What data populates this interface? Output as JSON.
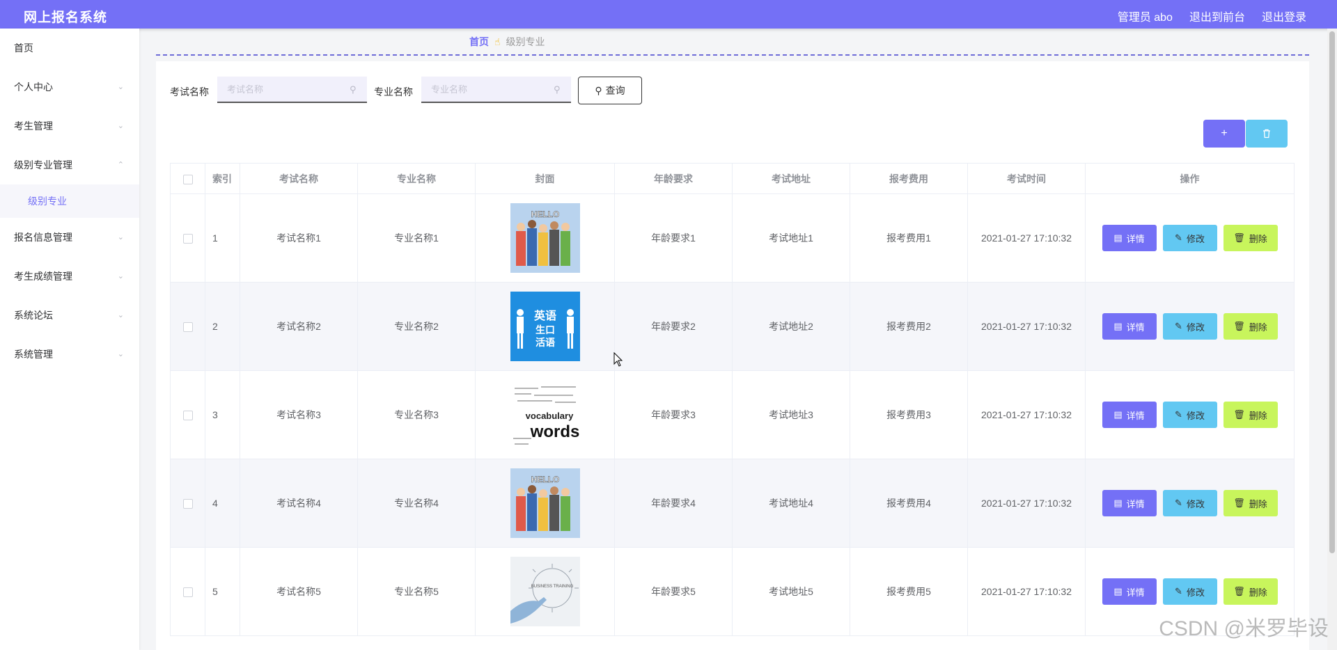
{
  "header": {
    "brand": "网上报名系统",
    "admin": "管理员 abo",
    "to_front": "退出到前台",
    "logout": "退出登录"
  },
  "sidebar": {
    "items": [
      {
        "label": "首页",
        "expandable": false
      },
      {
        "label": "个人中心",
        "expandable": true
      },
      {
        "label": "考生管理",
        "expandable": true
      },
      {
        "label": "级别专业管理",
        "expandable": true,
        "expanded": true,
        "sub": "级别专业"
      },
      {
        "label": "报名信息管理",
        "expandable": true
      },
      {
        "label": "考生成绩管理",
        "expandable": true
      },
      {
        "label": "系统论坛",
        "expandable": true
      },
      {
        "label": "系统管理",
        "expandable": true
      }
    ]
  },
  "breadcrumb": {
    "home": "首页",
    "current": "级别专业"
  },
  "search": {
    "exam_label": "考试名称",
    "exam_placeholder": "考试名称",
    "major_label": "专业名称",
    "major_placeholder": "专业名称",
    "query_button": "查询"
  },
  "table": {
    "headers": [
      "索引",
      "考试名称",
      "专业名称",
      "封面",
      "年龄要求",
      "考试地址",
      "报考费用",
      "考试时间",
      "操作"
    ],
    "rows": [
      {
        "index": "1",
        "exam": "考试名称1",
        "major": "专业名称1",
        "cover": "hello-people",
        "age": "年龄要求1",
        "address": "考试地址1",
        "fee": "报考费用1",
        "time": "2021-01-27 17:10:32"
      },
      {
        "index": "2",
        "exam": "考试名称2",
        "major": "专业名称2",
        "cover": "english-oral",
        "age": "年龄要求2",
        "address": "考试地址2",
        "fee": "报考费用2",
        "time": "2021-01-27 17:10:32"
      },
      {
        "index": "3",
        "exam": "考试名称3",
        "major": "专业名称3",
        "cover": "vocabulary-words",
        "age": "年龄要求3",
        "address": "考试地址3",
        "fee": "报考费用3",
        "time": "2021-01-27 17:10:32"
      },
      {
        "index": "4",
        "exam": "考试名称4",
        "major": "专业名称4",
        "cover": "hello-people",
        "age": "年龄要求4",
        "address": "考试地址4",
        "fee": "报考费用4",
        "time": "2021-01-27 17:10:32"
      },
      {
        "index": "5",
        "exam": "考试名称5",
        "major": "专业名称5",
        "cover": "business-training",
        "age": "年龄要求5",
        "address": "考试地址5",
        "fee": "报考费用5",
        "time": "2021-01-27 17:10:32"
      }
    ],
    "actions": {
      "detail": "详情",
      "edit": "修改",
      "delete": "删除"
    }
  },
  "cover_text": {
    "hello": "HELLO",
    "en1": "英语",
    "en2": "生口",
    "en3": "活语",
    "vocab": "vocabulary",
    "words": "words",
    "biz": "BUSINESS TRAINING"
  },
  "watermark": "CSDN @米罗毕设",
  "colors": {
    "primary": "#7470f6",
    "info": "#62c8f2",
    "danger": "#c8f55c"
  }
}
